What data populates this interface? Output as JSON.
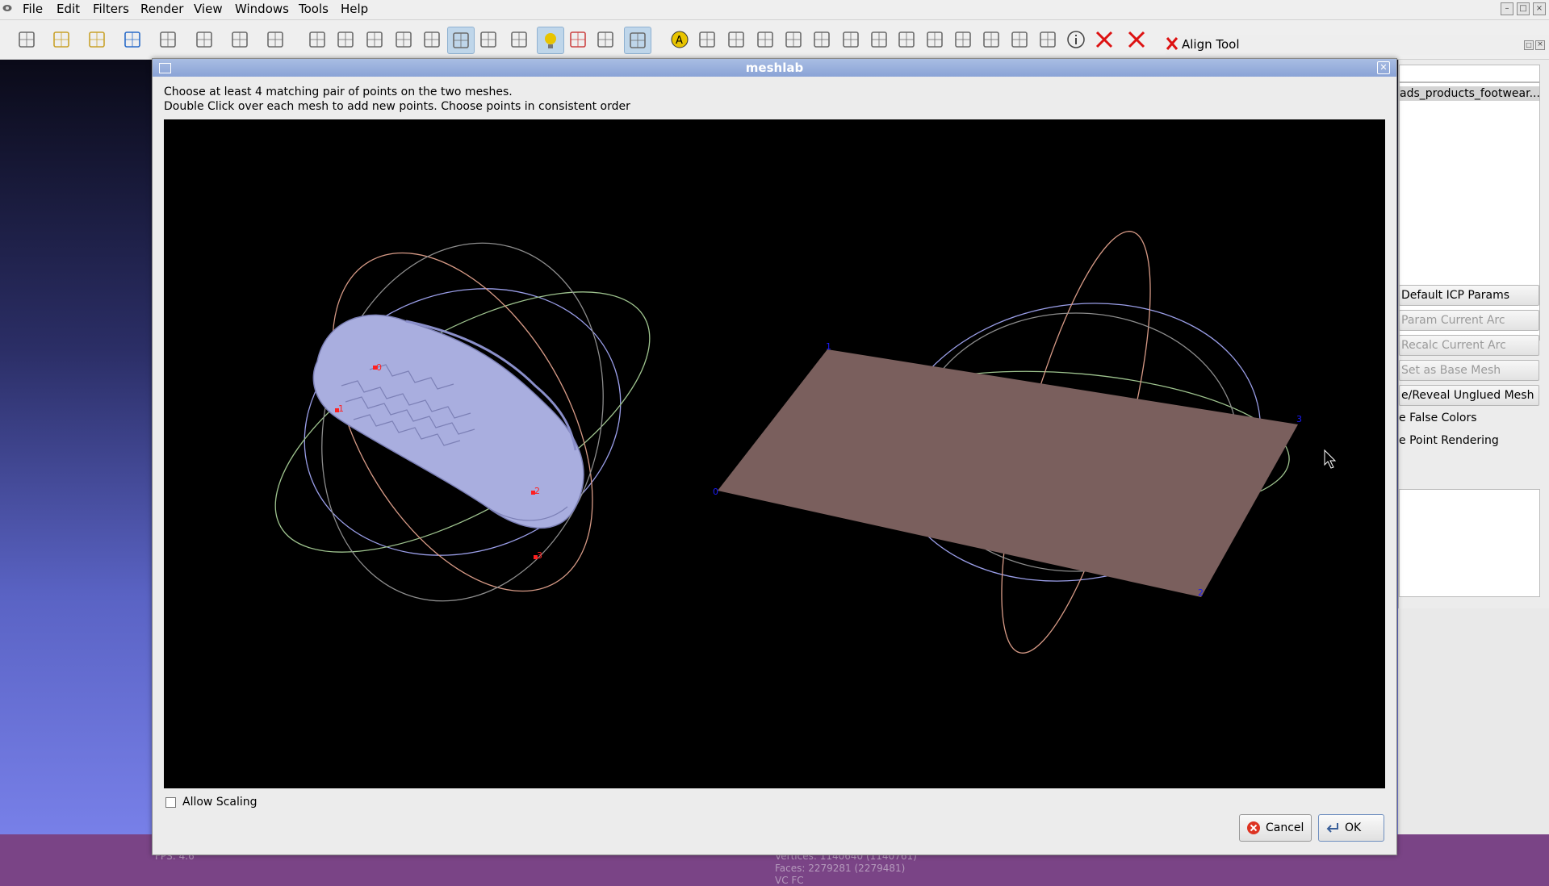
{
  "menubar": {
    "items": [
      "File",
      "Edit",
      "Filters",
      "Render",
      "View",
      "Windows",
      "Tools",
      "Help"
    ]
  },
  "toolbar": {
    "icons": [
      "new-document-icon",
      "open-folder-icon",
      "open-project-icon",
      "reload-icon",
      "save-icon",
      "snapshot-icon",
      "layers-icon",
      "globe-icon",
      "bounding-box-icon",
      "points-icon",
      "wireframe-icon",
      "hidden-lines-icon",
      "flat-lines-icon",
      "flat-icon",
      "smooth-icon",
      "texture-icon",
      "light-icon",
      "color-icon",
      "double-side-icon",
      "trackball-icon",
      "annotation-icon",
      "measure-icon",
      "sphere-icon",
      "axes-icon",
      "paint-icon",
      "brush-icon",
      "texture-paint-icon",
      "select-vertices-icon",
      "select-faces-icon",
      "select-connected-icon",
      "select-region-icon",
      "align-icon",
      "quality-mapper-icon",
      "raster-icon",
      "info-icon",
      "delete-layer-icon",
      "delete-selected-icon"
    ]
  },
  "align_tool": {
    "title": "Align Tool",
    "mesh_item": "ads_products_footwear...",
    "buttons": {
      "default_icp": "Default ICP Params",
      "param_current_arc": "Param Current Arc",
      "recalc_current_arc": "Recalc Current Arc",
      "set_base_mesh": "Set as Base Mesh",
      "hide_reveal": "e/Reveal Unglued Mesh"
    },
    "labels": {
      "false_colors": "e False Colors",
      "point_rendering": "e Point Rendering"
    }
  },
  "dialog": {
    "title": "meshlab",
    "instruction_1": "Choose at least 4 matching pair of points on the two meshes.",
    "instruction_2": "Double Click over each mesh to add new points. Choose points in consistent order",
    "allow_scaling": "Allow Scaling",
    "allow_scaling_checked": false,
    "cancel": "Cancel",
    "ok": "OK"
  },
  "left_mesh_points": [
    "0",
    "1",
    "2",
    "3"
  ],
  "right_mesh_points": [
    "0",
    "1",
    "2",
    "3"
  ],
  "status": {
    "fps": "FPS:   4.6",
    "vertices": "Vertices: 1140640 (1140761)",
    "faces": "Faces: 2279281 (2279481)",
    "vc": "VC FC"
  },
  "colors": {
    "mesh_shoe": "#a9aedf",
    "plane": "#7a5f5d",
    "point_marker_left": "#ff2020",
    "point_marker_right": "#1a1aff"
  }
}
